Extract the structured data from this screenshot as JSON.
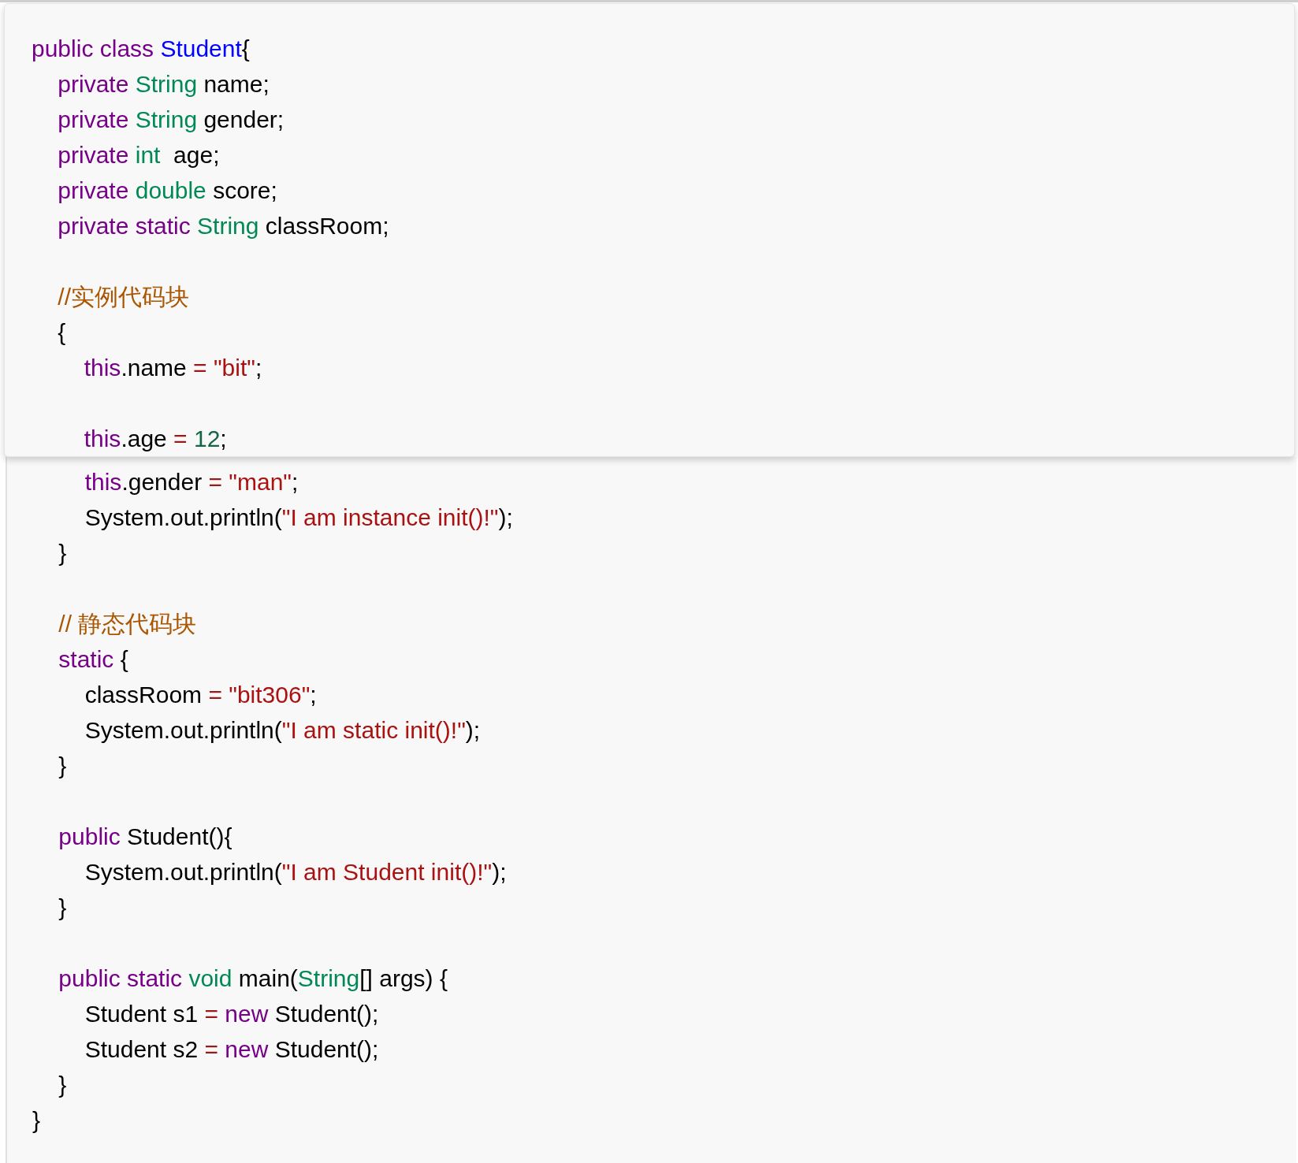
{
  "popup": {
    "lines": [
      {
        "kind": "code",
        "tokens": [
          {
            "kind": "keyword",
            "text": "public class "
          },
          {
            "kind": "classname",
            "text": "Student"
          },
          {
            "kind": "plain",
            "text": "{"
          }
        ]
      },
      {
        "kind": "code",
        "tokens": [
          {
            "kind": "keyword",
            "text": "    private "
          },
          {
            "kind": "type",
            "text": "String"
          },
          {
            "kind": "plain",
            "text": " name;"
          }
        ]
      },
      {
        "kind": "code",
        "tokens": [
          {
            "kind": "keyword",
            "text": "    private "
          },
          {
            "kind": "type",
            "text": "String"
          },
          {
            "kind": "plain",
            "text": " gender;"
          }
        ]
      },
      {
        "kind": "code",
        "tokens": [
          {
            "kind": "keyword",
            "text": "    private "
          },
          {
            "kind": "type",
            "text": "int"
          },
          {
            "kind": "plain",
            "text": "  age;"
          }
        ]
      },
      {
        "kind": "code",
        "tokens": [
          {
            "kind": "keyword",
            "text": "    private "
          },
          {
            "kind": "type",
            "text": "double"
          },
          {
            "kind": "plain",
            "text": " score;"
          }
        ]
      },
      {
        "kind": "code",
        "tokens": [
          {
            "kind": "keyword",
            "text": "    private static "
          },
          {
            "kind": "type",
            "text": "String"
          },
          {
            "kind": "plain",
            "text": " classRoom;"
          }
        ]
      },
      {
        "kind": "blank"
      },
      {
        "kind": "code",
        "tokens": [
          {
            "kind": "comment",
            "text": "    //实例代码块"
          }
        ]
      },
      {
        "kind": "code",
        "tokens": [
          {
            "kind": "plain",
            "text": "    {"
          }
        ]
      },
      {
        "kind": "code",
        "tokens": [
          {
            "kind": "keyword",
            "text": "        this"
          },
          {
            "kind": "plain",
            "text": ".name "
          },
          {
            "kind": "operator",
            "text": "= "
          },
          {
            "kind": "string",
            "text": "\"bit\""
          },
          {
            "kind": "plain",
            "text": ";"
          }
        ]
      },
      {
        "kind": "blank"
      },
      {
        "kind": "code",
        "tokens": [
          {
            "kind": "keyword",
            "text": "        this"
          },
          {
            "kind": "plain",
            "text": ".age "
          },
          {
            "kind": "operator",
            "text": "= "
          },
          {
            "kind": "number",
            "text": "12"
          },
          {
            "kind": "plain",
            "text": ";"
          }
        ]
      }
    ]
  },
  "code": {
    "lines": [
      {
        "kind": "code",
        "tokens": [
          {
            "kind": "keyword",
            "text": "        this"
          },
          {
            "kind": "plain",
            "text": ".gender "
          },
          {
            "kind": "operator",
            "text": "= "
          },
          {
            "kind": "string",
            "text": "\"man\""
          },
          {
            "kind": "plain",
            "text": ";"
          }
        ]
      },
      {
        "kind": "code",
        "tokens": [
          {
            "kind": "plain",
            "text": "        System.out.println("
          },
          {
            "kind": "string",
            "text": "\"I am instance init()!\""
          },
          {
            "kind": "plain",
            "text": ");"
          }
        ]
      },
      {
        "kind": "code",
        "tokens": [
          {
            "kind": "plain",
            "text": "    }"
          }
        ]
      },
      {
        "kind": "blank"
      },
      {
        "kind": "code",
        "tokens": [
          {
            "kind": "comment",
            "text": "    // 静态代码块"
          }
        ]
      },
      {
        "kind": "code",
        "tokens": [
          {
            "kind": "keyword",
            "text": "    static"
          },
          {
            "kind": "plain",
            "text": " {"
          }
        ]
      },
      {
        "kind": "code",
        "tokens": [
          {
            "kind": "plain",
            "text": "        classRoom "
          },
          {
            "kind": "operator",
            "text": "= "
          },
          {
            "kind": "string",
            "text": "\"bit306\""
          },
          {
            "kind": "plain",
            "text": ";"
          }
        ]
      },
      {
        "kind": "code",
        "tokens": [
          {
            "kind": "plain",
            "text": "        System.out.println("
          },
          {
            "kind": "string",
            "text": "\"I am static init()!\""
          },
          {
            "kind": "plain",
            "text": ");"
          }
        ]
      },
      {
        "kind": "code",
        "tokens": [
          {
            "kind": "plain",
            "text": "    }"
          }
        ]
      },
      {
        "kind": "blank"
      },
      {
        "kind": "code",
        "tokens": [
          {
            "kind": "keyword",
            "text": "    public"
          },
          {
            "kind": "plain",
            "text": " Student(){"
          }
        ]
      },
      {
        "kind": "code",
        "tokens": [
          {
            "kind": "plain",
            "text": "        System.out.println("
          },
          {
            "kind": "string",
            "text": "\"I am Student init()!\""
          },
          {
            "kind": "plain",
            "text": ");"
          }
        ]
      },
      {
        "kind": "code",
        "tokens": [
          {
            "kind": "plain",
            "text": "    }"
          }
        ]
      },
      {
        "kind": "blank"
      },
      {
        "kind": "code",
        "tokens": [
          {
            "kind": "keyword",
            "text": "    public static "
          },
          {
            "kind": "type",
            "text": "void"
          },
          {
            "kind": "plain",
            "text": " main("
          },
          {
            "kind": "type",
            "text": "String"
          },
          {
            "kind": "plain",
            "text": "[] args) {"
          }
        ]
      },
      {
        "kind": "code",
        "tokens": [
          {
            "kind": "plain",
            "text": "        Student s1 "
          },
          {
            "kind": "operator",
            "text": "="
          },
          {
            "kind": "keyword",
            "text": " new"
          },
          {
            "kind": "plain",
            "text": " Student();"
          }
        ]
      },
      {
        "kind": "code",
        "tokens": [
          {
            "kind": "plain",
            "text": "        Student s2 "
          },
          {
            "kind": "operator",
            "text": "="
          },
          {
            "kind": "keyword",
            "text": " new"
          },
          {
            "kind": "plain",
            "text": " Student();"
          }
        ]
      },
      {
        "kind": "code",
        "tokens": [
          {
            "kind": "plain",
            "text": "    }"
          }
        ]
      },
      {
        "kind": "code",
        "tokens": [
          {
            "kind": "plain",
            "text": "}"
          }
        ]
      }
    ]
  }
}
